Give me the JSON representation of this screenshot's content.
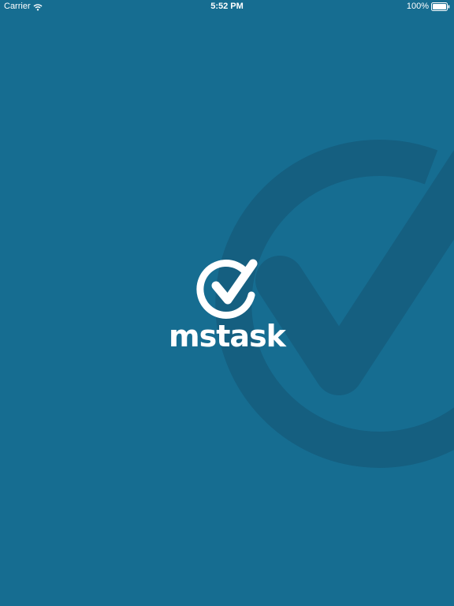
{
  "status_bar": {
    "carrier": "Carrier",
    "time": "5:52 PM",
    "battery_percent": "100%",
    "battery_level": 1.0,
    "wifi_icon": "wifi-icon",
    "battery_icon": "battery-icon"
  },
  "splash": {
    "brand_name": "mstask",
    "logo_icon": "checkmark-circle-icon",
    "watermark_icon": "checkmark-circle-icon"
  },
  "colors": {
    "background": "#166d91",
    "watermark": "#155f80",
    "foreground": "#ffffff"
  }
}
